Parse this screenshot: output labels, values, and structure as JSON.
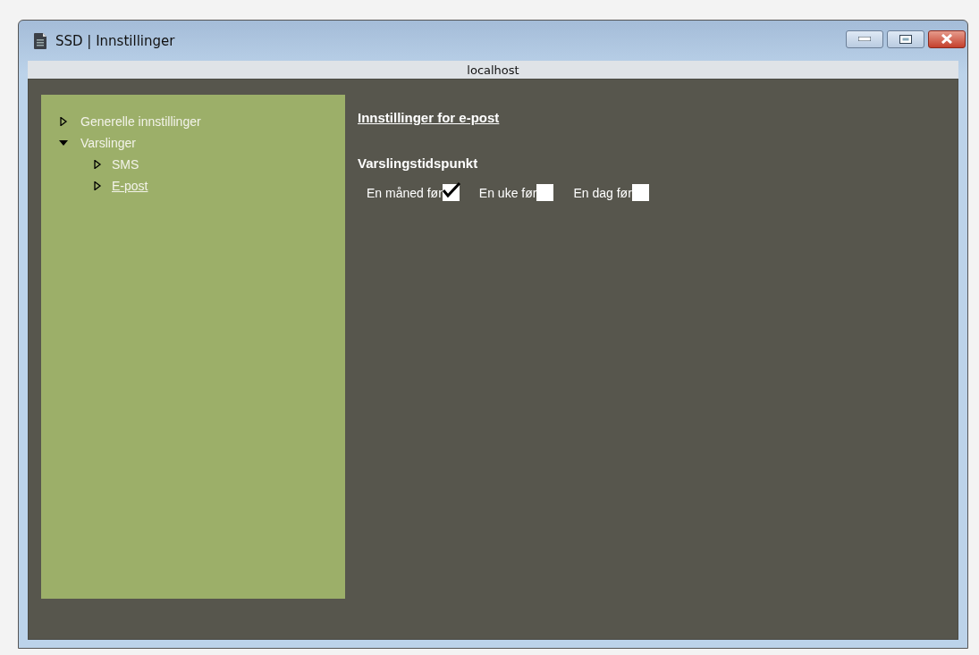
{
  "window": {
    "title": "SSD | Innstillinger"
  },
  "address_bar": {
    "text": "localhost"
  },
  "sidebar": {
    "items": [
      {
        "label": "Generelle innstillinger",
        "expanded": false,
        "selected": false
      },
      {
        "label": "Varslinger",
        "expanded": true,
        "selected": false,
        "children": [
          {
            "label": "SMS",
            "expanded": false,
            "selected": false
          },
          {
            "label": "E-post",
            "expanded": false,
            "selected": true
          }
        ]
      }
    ]
  },
  "main": {
    "heading": "Innstillinger for e-post",
    "section_title": "Varslingstidspunkt",
    "checkboxes": [
      {
        "label": "En måned før",
        "checked": true
      },
      {
        "label": "En uke før",
        "checked": false
      },
      {
        "label": "En dag før",
        "checked": false
      }
    ]
  }
}
